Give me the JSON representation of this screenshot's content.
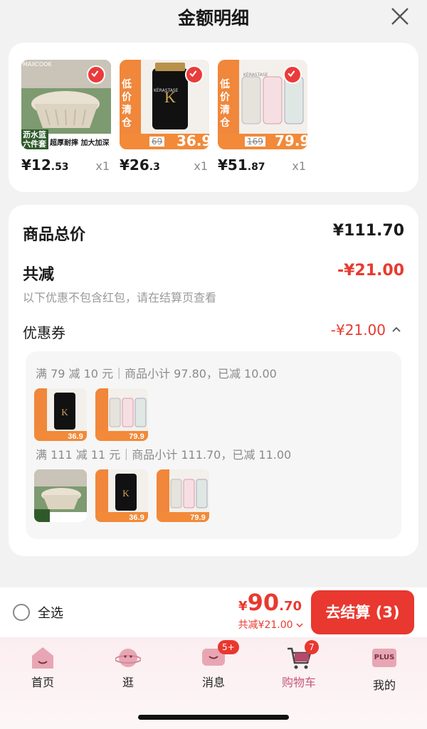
{
  "header": {
    "title": "金额明细"
  },
  "products": [
    {
      "price_main": "¥12",
      "price_dec": ".53",
      "qty": "x1",
      "thumb_caption": "沥水篮六件套",
      "thumb_tag": "超厚耐摔 加大加深",
      "thumb_brand": "MAXCOOK"
    },
    {
      "price_main": "¥26",
      "price_dec": ".3",
      "qty": "x1",
      "thumb_caption": "低价清仓",
      "thumb_old": "69",
      "thumb_new": "36.9",
      "thumb_brand": "KÉRASTASE"
    },
    {
      "price_main": "¥51",
      "price_dec": ".87",
      "qty": "x1",
      "thumb_caption": "低价清仓",
      "thumb_old": "169",
      "thumb_new": "79.9",
      "thumb_brand": "KÉRASTASE"
    }
  ],
  "summary": {
    "total_label": "商品总价",
    "total_value": "¥111.70",
    "discount_label": "共减",
    "discount_value": "-¥21.00",
    "note": "以下优惠不包含红包，请在结算页查看",
    "coupon_label": "优惠券",
    "coupon_value": "-¥21.00"
  },
  "coupon_rules": [
    {
      "text": "满 79 减 10 元｜商品小计 97.80，已减 10.00"
    },
    {
      "text": "满 111 减 11 元｜商品小计 111.70，已减 11.00"
    }
  ],
  "bottom": {
    "select_all": "全选",
    "pay_currency": "¥",
    "pay_int": "90",
    "pay_dec": ".70",
    "saved": "共减¥21.00",
    "checkout": "去结算 (3)"
  },
  "tabs": [
    {
      "label": "首页",
      "icon": "home-icon"
    },
    {
      "label": "逛",
      "icon": "planet-icon"
    },
    {
      "label": "消息",
      "icon": "message-icon",
      "badge": "5+"
    },
    {
      "label": "购物车",
      "icon": "cart-icon",
      "badge": "7",
      "active": true
    },
    {
      "label": "我的",
      "icon": "plus-icon",
      "icon_text": "PLUS"
    }
  ],
  "colors": {
    "accent": "#e83a2f",
    "active_tab": "#c4587e"
  }
}
